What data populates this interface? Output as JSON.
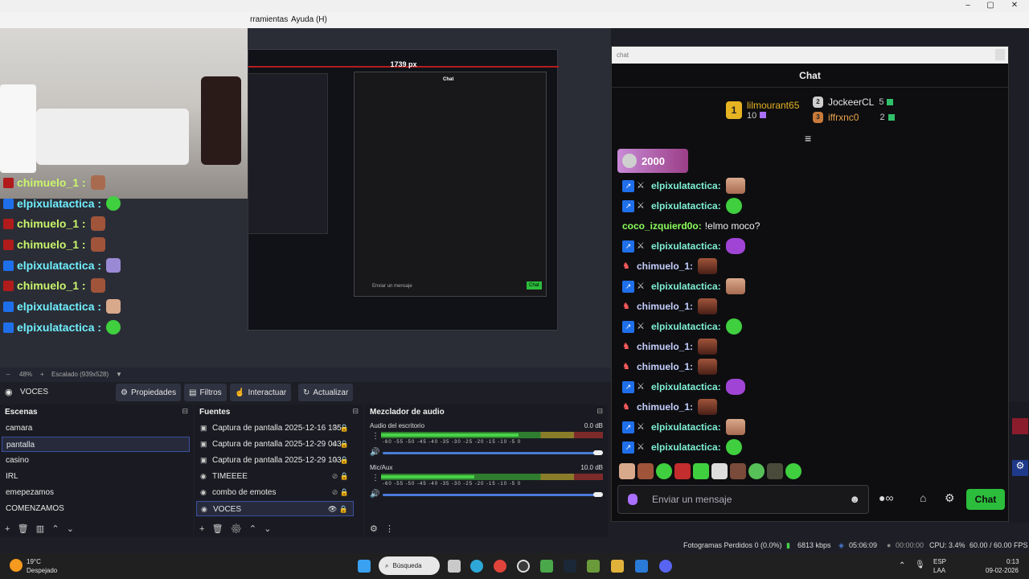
{
  "menu": {
    "items": [
      "rramientas",
      "Ayuda (H)"
    ],
    "window_controls": [
      "–",
      "▢",
      "✕"
    ]
  },
  "preview": {
    "px_label": "1739 px",
    "overlay_chat": [
      {
        "user": "chimuelo_1 :",
        "color": "green",
        "badge": "red"
      },
      {
        "user": "elpixulatactica :",
        "color": "cyan",
        "badge": "blue"
      },
      {
        "user": "chimuelo_1 :",
        "color": "green",
        "badge": "red"
      },
      {
        "user": "chimuelo_1 :",
        "color": "green",
        "badge": "red"
      },
      {
        "user": "elpixulatactica :",
        "color": "cyan",
        "badge": "blue"
      },
      {
        "user": "chimuelo_1 :",
        "color": "green",
        "badge": "red"
      },
      {
        "user": "elpixulatactica :",
        "color": "cyan",
        "badge": "blue"
      },
      {
        "user": "elpixulatactica :",
        "color": "cyan",
        "badge": "blue"
      }
    ],
    "mini_chat_title": "Chat",
    "mini_chat_input": "Enviar un mensaje",
    "mini_chat_send": "Chat"
  },
  "zoom": {
    "minus": "–",
    "value": "48%",
    "plus": "+",
    "scale": "Escalado (939x528)"
  },
  "toolbar": {
    "source_name": "VOCES",
    "properties": "Propiedades",
    "filters": "Filtros",
    "interact": "Interactuar",
    "refresh": "Actualizar"
  },
  "scenes": {
    "title": "Escenas",
    "items": [
      "camara",
      "pantalla",
      "casino",
      "IRL",
      "emepezamos",
      "COMENZAMOS"
    ],
    "selected": 1
  },
  "sources": {
    "title": "Fuentes",
    "items": [
      {
        "name": "Captura de pantalla 2025-12-16 135",
        "icon": "monitor-icon"
      },
      {
        "name": "Captura de pantalla 2025-12-29 043",
        "icon": "monitor-icon"
      },
      {
        "name": "Captura de pantalla 2025-12-29 103",
        "icon": "monitor-icon"
      },
      {
        "name": "TIMEEEE",
        "icon": "globe-icon"
      },
      {
        "name": "combo de emotes",
        "icon": "globe-icon"
      },
      {
        "name": "VOCES",
        "icon": "globe-icon"
      }
    ],
    "selected": 5
  },
  "mixer": {
    "title": "Mezclador de audio",
    "tracks": [
      {
        "name": "Audio del escritorio",
        "db": "0.0 dB",
        "level": 0.62
      },
      {
        "name": "Mic/Aux",
        "db": "10.0 dB",
        "level": 0.42
      }
    ],
    "ticks": "-60 -55 -50 -45 -40 -35 -30 -25 -20 -15 -10 -5 0"
  },
  "chat": {
    "window_title": "chat",
    "header": "Chat",
    "leaderboard": [
      {
        "rank": "1",
        "name": "lilmourant65",
        "score": "10"
      },
      {
        "rank": "2",
        "name": "JockeerCL",
        "score": "5"
      },
      {
        "rank": "3",
        "name": "iffrxnc0",
        "score": "2"
      }
    ],
    "hype_value": "2000",
    "messages": [
      {
        "user": "elpixulatactica:",
        "badge": "blue",
        "emote": "face",
        "text": ""
      },
      {
        "user": "elpixulatactica:",
        "badge": "blue",
        "emote": "green",
        "text": ""
      },
      {
        "user": "coco_izquierd0o:",
        "badge": "none",
        "emote": "",
        "text": "!elmo moco?"
      },
      {
        "user": "elpixulatactica:",
        "badge": "blue",
        "emote": "purple",
        "text": ""
      },
      {
        "user": "chimuelo_1:",
        "badge": "red",
        "emote": "man",
        "text": ""
      },
      {
        "user": "elpixulatactica:",
        "badge": "blue",
        "emote": "face",
        "text": ""
      },
      {
        "user": "chimuelo_1:",
        "badge": "red",
        "emote": "man",
        "text": ""
      },
      {
        "user": "elpixulatactica:",
        "badge": "blue",
        "emote": "green",
        "text": ""
      },
      {
        "user": "chimuelo_1:",
        "badge": "red",
        "emote": "man",
        "text": ""
      },
      {
        "user": "chimuelo_1:",
        "badge": "red",
        "emote": "man",
        "text": ""
      },
      {
        "user": "elpixulatactica:",
        "badge": "blue",
        "emote": "purple",
        "text": ""
      },
      {
        "user": "chimuelo_1:",
        "badge": "red",
        "emote": "man",
        "text": ""
      },
      {
        "user": "elpixulatactica:",
        "badge": "blue",
        "emote": "face",
        "text": ""
      },
      {
        "user": "elpixulatactica:",
        "badge": "blue",
        "emote": "green",
        "text": ""
      }
    ],
    "input_placeholder": "Enviar un mensaje",
    "send_label": "Chat"
  },
  "status": {
    "dropped_frames": "Fotogramas Perdidos 0 (0.0%)",
    "bitrate": "6813 kbps",
    "stream_time": "05:06:09",
    "rec_time": "00:00:00",
    "cpu": "CPU: 3.4%",
    "fps": "60.00 / 60.00 FPS"
  },
  "taskbar": {
    "weather_temp": "19°C",
    "weather_desc": "Despejado",
    "search": "Búsqueda",
    "lang_top": "ESP",
    "lang_bottom": "LAA",
    "time": "0:13",
    "date": "09-02-2026"
  },
  "colors": {
    "accent_purple": "#a970ff",
    "twitch_green_send": "#2bbd3b",
    "gold": "#e6b422"
  }
}
